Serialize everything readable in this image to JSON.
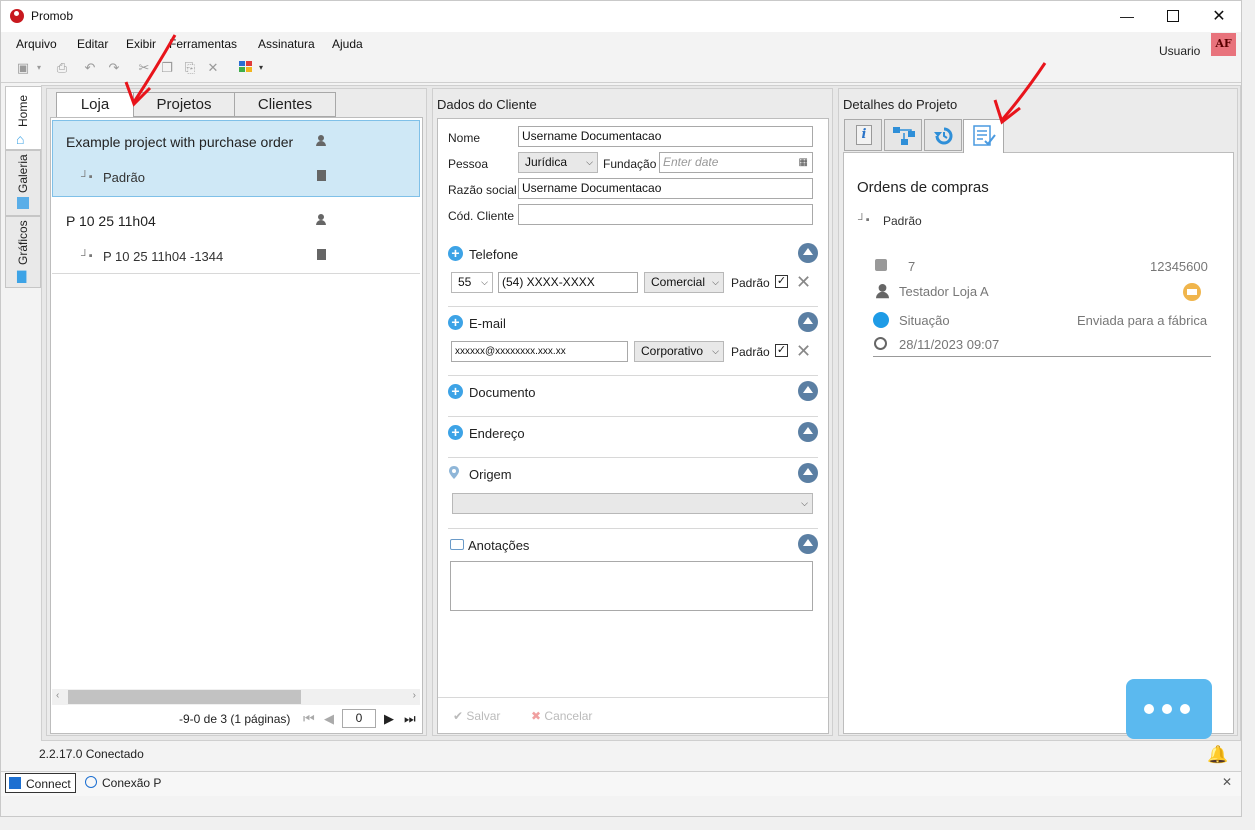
{
  "window": {
    "title": "Promob",
    "min_icon": "minimize-icon",
    "max_icon": "maximize-icon",
    "close_icon": "close-icon"
  },
  "menu": {
    "items": [
      "Arquivo",
      "Editar",
      "Exibir",
      "Ferramentas",
      "Assinatura",
      "Ajuda"
    ]
  },
  "user": {
    "label": "Usuario",
    "initials": "AF"
  },
  "side_tabs": [
    "Home",
    "Galeria",
    "Gráficos"
  ],
  "left_panel": {
    "tabs": [
      "Loja",
      "Projetos",
      "Clientes"
    ],
    "items": [
      {
        "title": "Example project with purchase order",
        "sub": "Padrão"
      },
      {
        "title": "P 10 25 11h04",
        "sub": "P 10 25 11h04 -1344"
      }
    ],
    "pager": {
      "text": "-9-0 de 3 (1 páginas)",
      "page": "0"
    }
  },
  "client": {
    "title": "Dados do Cliente",
    "nome_label": "Nome",
    "nome_value": "Username Documentacao",
    "pessoa_label": "Pessoa",
    "pessoa_value": "Jurídica",
    "fundacao_label": "Fundação",
    "fundacao_placeholder": "Enter date",
    "razao_label": "Razão social",
    "razao_value": "Username Documentacao",
    "cod_label": "Cód. Cliente",
    "cod_value": "",
    "telefone": {
      "label": "Telefone",
      "ddi": "55",
      "number": "(54) XXXX-XXXX",
      "type": "Comercial",
      "padrao": "Padrão"
    },
    "email": {
      "label": "E-mail",
      "value": "xxxxxx@xxxxxxxx.xxx.xx",
      "type": "Corporativo",
      "padrao": "Padrão"
    },
    "documento_label": "Documento",
    "endereco_label": "Endereço",
    "origem_label": "Origem",
    "anotacoes_label": "Anotações",
    "save_label": "Salvar",
    "cancel_label": "Cancelar"
  },
  "project": {
    "title": "Detalhes do Projeto",
    "orders_title": "Ordens de compras",
    "padrao": "Padrão",
    "order_number": "7",
    "order_code": "12345600",
    "store": "Testador Loja A",
    "situacao_label": "Situação",
    "situacao_value": "Enviada para a fábrica",
    "date": "28/11/2023 09:07"
  },
  "status": {
    "version": "2.2.17.0 Conectado",
    "connect": "Connect",
    "conexao": "Conexão P"
  },
  "colors": {
    "accent": "#3da3e6",
    "selection": "#cfe8f6",
    "chat": "#5bb9ef",
    "status_dot": "#1e9be6",
    "arrow": "#e8141b"
  }
}
